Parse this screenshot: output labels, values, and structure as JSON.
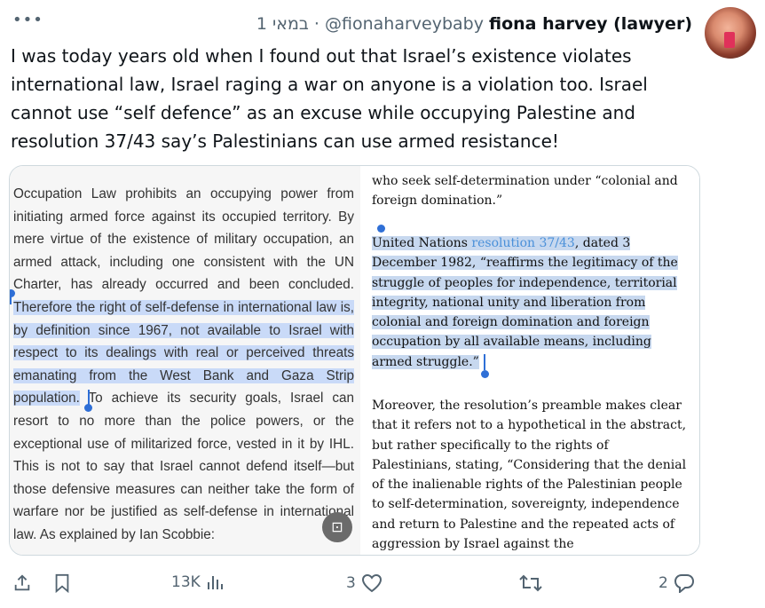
{
  "header": {
    "more_label": "•••",
    "time": "1 במאי",
    "separator": "·",
    "handle": "@fionaharveybaby",
    "display_name": "fiona harvey (lawyer)"
  },
  "tweet": {
    "lines": [
      "I was today years old when I found out that Israel’s existence violates",
      "international law, Israel raging a war on anyone is a violation too. Israel",
      "cannot use “self defence” as an excuse while occupying Palestine and",
      "resolution 37/43 say’s Palestinians can use armed resistance!"
    ]
  },
  "media": {
    "left": {
      "before": "Occupation Law prohibits an occupying power from initiating armed force against its occupied territory. By mere virtue of the existence of military occupation, an armed attack, including one consistent with the UN Charter, has already occurred and been concluded.",
      "selected": "Therefore the right of self-defense in international law is, by definition since 1967, not available to Israel with respect to its dealings with real or perceived threats emanating from the West Bank and Gaza Strip population.",
      "after": "To achieve its security goals, Israel can resort to no more than the police powers, or the exceptional use of militarized force, vested in it by IHL. This is not to say that Israel cannot defend itself—but those defensive measures can neither take the form of warfare nor be justified as self-defense in international law. As explained by Ian Scobbie:"
    },
    "right": {
      "top": "who seek self-determination under “colonial and foreign domination.”",
      "sel_start": "United Nations ",
      "link": "resolution 37/43",
      "sel_end": ", dated 3 December 1982, “reaffirms the legitimacy of the struggle of peoples for independence, territorial integrity, national unity and liberation from colonial and foreign domination and foreign occupation by all available means, including armed struggle.”",
      "bottom": "Moreover, the resolution’s preamble makes clear that it refers not to a hypothetical in the abstract, but rather specifically to the rights of Palestinians, stating, “Considering that the denial of the inalienable rights of the Palestinian people to self-determination, sovereignty, independence and return to Palestine and the repeated acts of aggression by Israel against the"
    }
  },
  "actions": {
    "views": "13K",
    "likes": "3",
    "replies": "2"
  },
  "colors": {
    "muted": "#536471",
    "selection": "#c9daf8",
    "link": "#4a90d9"
  }
}
